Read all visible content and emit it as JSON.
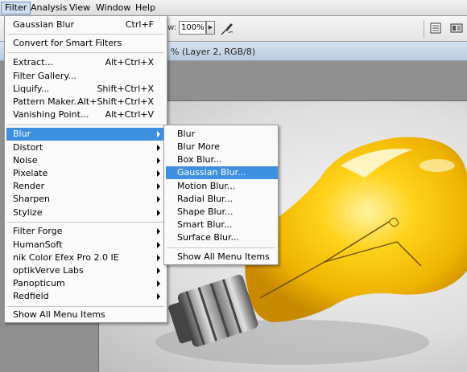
{
  "menubar": {
    "items": [
      {
        "label": "Filter"
      },
      {
        "label": "Analysis"
      },
      {
        "label": "View"
      },
      {
        "label": "Window"
      },
      {
        "label": "Help"
      }
    ]
  },
  "options": {
    "flow_label": "ow:",
    "zoom_value": "100%",
    "zoom_arrow": "▶"
  },
  "document": {
    "title": "% (Layer 2, RGB/8)"
  },
  "filter_menu": {
    "last_filter": {
      "label": "Gaussian Blur",
      "shortcut": "Ctrl+F"
    },
    "convert": {
      "label": "Convert for Smart Filters"
    },
    "extract": {
      "label": "Extract...",
      "shortcut": "Alt+Ctrl+X"
    },
    "gallery": {
      "label": "Filter Gallery..."
    },
    "liquify": {
      "label": "Liquify...",
      "shortcut": "Shift+Ctrl+X"
    },
    "pattern": {
      "label": "Pattern Maker...",
      "shortcut": "Alt+Shift+Ctrl+X"
    },
    "vanishing": {
      "label": "Vanishing Point...",
      "shortcut": "Alt+Ctrl+V"
    },
    "blur": {
      "label": "Blur"
    },
    "distort": {
      "label": "Distort"
    },
    "noise": {
      "label": "Noise"
    },
    "pixelate": {
      "label": "Pixelate"
    },
    "render": {
      "label": "Render"
    },
    "sharpen": {
      "label": "Sharpen"
    },
    "stylize": {
      "label": "Stylize"
    },
    "filter_forge": {
      "label": "Filter Forge"
    },
    "humansoft": {
      "label": "HumanSoft"
    },
    "nik": {
      "label": "nik Color Efex Pro 2.0 IE"
    },
    "optikverve": {
      "label": "optikVerve Labs"
    },
    "panopticum": {
      "label": "Panopticum"
    },
    "redfield": {
      "label": "Redfield"
    },
    "show_all": {
      "label": "Show All Menu Items"
    }
  },
  "blur_menu": {
    "blur": {
      "label": "Blur"
    },
    "blur_more": {
      "label": "Blur More"
    },
    "box_blur": {
      "label": "Box Blur..."
    },
    "gaussian_blur": {
      "label": "Gaussian Blur..."
    },
    "motion_blur": {
      "label": "Motion Blur..."
    },
    "radial_blur": {
      "label": "Radial Blur..."
    },
    "shape_blur": {
      "label": "Shape Blur..."
    },
    "smart_blur": {
      "label": "Smart Blur..."
    },
    "surface_blur": {
      "label": "Surface Blur..."
    },
    "show_all": {
      "label": "Show All Menu Items"
    }
  },
  "colors": {
    "menu_highlight": "#3e8fe0",
    "bulb_yellow": "#f5c400",
    "titlebar_blue": "#c6d6e8"
  }
}
